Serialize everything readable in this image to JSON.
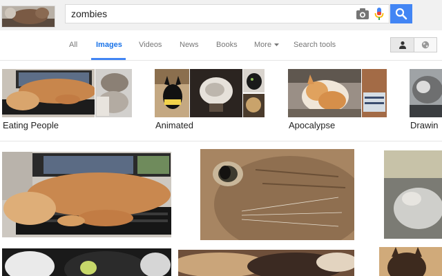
{
  "search": {
    "query": "zombies"
  },
  "nav": {
    "tabs": [
      {
        "label": "All"
      },
      {
        "label": "Images"
      },
      {
        "label": "Videos"
      },
      {
        "label": "News"
      },
      {
        "label": "Books"
      },
      {
        "label": "More"
      },
      {
        "label": "Search tools"
      }
    ],
    "active_tab": "Images"
  },
  "related_searches": [
    {
      "label": "Eating People"
    },
    {
      "label": "Animated"
    },
    {
      "label": "Apocalypse"
    },
    {
      "label": "Drawin"
    }
  ],
  "icons": {
    "camera": "camera-icon",
    "mic": "mic-icon",
    "search": "search-icon",
    "person": "person-icon",
    "globe": "globe-icon",
    "caret": "caret-down-icon"
  },
  "colors": {
    "accent": "#4285f4",
    "topbar_bg": "#f1f1f1"
  }
}
